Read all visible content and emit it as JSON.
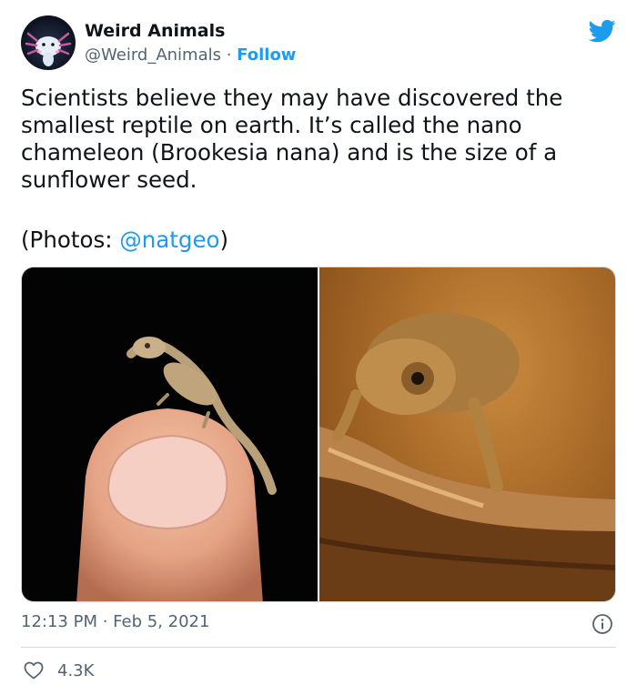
{
  "author": {
    "name": "Weird Animals",
    "handle": "@Weird_Animals",
    "separator": " · ",
    "follow_label": "Follow",
    "avatar_icon": "axolotl-avatar"
  },
  "tweet": {
    "text": "Scientists believe they may have discovered the smallest reptile on earth. It’s called the nano chameleon (Brookesia nana) and is the size of a sunflower seed.",
    "photos_prefix": "(Photos: ",
    "photos_mention": "@natgeo",
    "photos_suffix": ")"
  },
  "media": {
    "photos": [
      {
        "description_icon": "chameleon-on-fingertip-photo"
      },
      {
        "description_icon": "chameleon-on-branch-photo"
      }
    ]
  },
  "meta": {
    "timestamp": "12:13 PM · Feb 5, 2021",
    "likes": "4.3K"
  },
  "colors": {
    "accent": "#1d9bf0",
    "secondary_text": "#536471",
    "divider": "#cfd9de"
  }
}
